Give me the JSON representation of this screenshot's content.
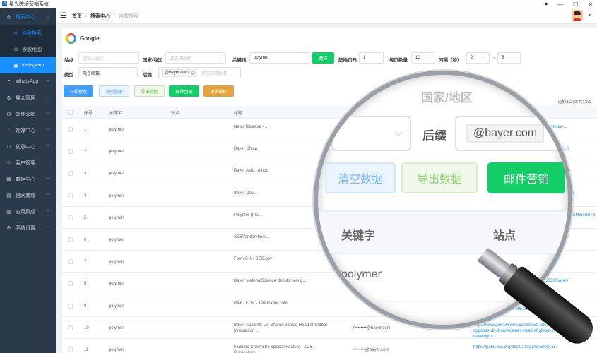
{
  "app": {
    "title": "星光跨境营销系统",
    "logo_letter": "S"
  },
  "window_controls": {
    "record": "⏺",
    "minimize": "—",
    "maximize": "☐",
    "close": "✕"
  },
  "sidebar": {
    "search_group": "搜索中心",
    "search_items": [
      {
        "label": "谷歌搜索",
        "icon": "google-icon",
        "glyph": "◎"
      },
      {
        "label": "谷歌地图",
        "icon": "map-pin-icon",
        "glyph": "⊙"
      },
      {
        "label": "Instagram",
        "icon": "instagram-icon",
        "glyph": "▣"
      }
    ],
    "groups": [
      {
        "label": "WhatsApp",
        "icon": "whatsapp-icon",
        "glyph": "◔"
      },
      {
        "label": "展会管理",
        "icon": "exhibition-icon",
        "glyph": "⚙"
      },
      {
        "label": "邮件营销",
        "icon": "mail-icon",
        "glyph": "✉"
      },
      {
        "label": "社媒中心",
        "icon": "social-icon",
        "glyph": "◌"
      },
      {
        "label": "创意中心",
        "icon": "creative-icon",
        "glyph": "☐"
      },
      {
        "label": "客户管理",
        "icon": "customer-icon",
        "glyph": "☺"
      },
      {
        "label": "数据中心",
        "icon": "data-icon",
        "glyph": "▦"
      },
      {
        "label": "官网商城",
        "icon": "shop-icon",
        "glyph": "▤"
      },
      {
        "label": "应用集成",
        "icon": "apps-icon",
        "glyph": "▥"
      },
      {
        "label": "系统设置",
        "icon": "settings-icon",
        "glyph": "⚙"
      }
    ]
  },
  "header": {
    "crumbs": [
      "首页",
      "搜索中心",
      "谷歌搜索"
    ]
  },
  "engine": {
    "name": "Google"
  },
  "form": {
    "site_label": "站点",
    "site_placeholder": "请输入站点",
    "country_label": "国家/地区",
    "country_placeholder": "请选择国家",
    "keyword_label": "关键词",
    "keyword_value": "polymer",
    "translate_btn": "翻译",
    "start_page_label": "起始页码",
    "start_page_value": "1",
    "per_page_label": "每页数量",
    "per_page_value": "10",
    "interval_label": "间隔（秒）",
    "interval_min": "2",
    "interval_dash": "~",
    "interval_max": "5",
    "type_label": "类型",
    "type_value": "电子邮箱",
    "suffix_label": "后缀",
    "suffix_tag": "@bayer.com",
    "suffix_placeholder": "添加邮箱后缀"
  },
  "actions": {
    "start": "开始搜索",
    "clear": "清空数据",
    "export": "导出数据",
    "email": "邮件营销",
    "more": "更多操作"
  },
  "summary": "已抓取2页/共12条",
  "table": {
    "headers": [
      "序号",
      "关键字",
      "站点",
      "标题"
    ],
    "rows": [
      {
        "no": "1",
        "kw": "polymer",
        "title": "News Release - ...",
        "email": "",
        "url": "...bayer.com/sites/default/files/otto-bayer-medal-..."
      },
      {
        "no": "2",
        "kw": "polymer",
        "title": "Bayer China",
        "email": "",
        "url": "...bayer.com.cn/index.php/AboutBayer/BayerChi...?lw=us"
      },
      {
        "no": "3",
        "kw": "polymer",
        "title": "Bayer Akti... d-hoc",
        "email": "",
        "url": "...bayer.de/news/adhoc/bayer-aktienge...ons-ipo-for-covestro/897155"
      },
      {
        "no": "4",
        "kw": "polymer",
        "title": "Bayer Dev...",
        "email": "",
        "url": "...systems.com/news-events/bayer-deve...gnostic-test-for-cancer-patients-fdge..."
      },
      {
        "no": "5",
        "kw": "polymer",
        "title": "Polymer (Pla...",
        "email": "",
        "url": "...com/materials/polymers/properties/sup...tionID=PC&MinorID=3"
      },
      {
        "no": "6",
        "kw": "polymer",
        "title": "SESVanderHave...",
        "email": "",
        "url": "...m/news/collaboration_for_new_..."
      },
      {
        "no": "7",
        "kw": "polymer",
        "title": "Form 6-K - SEC.gov",
        "email": "",
        "url": "...001433/0001..."
      },
      {
        "no": "8",
        "kw": "polymer",
        "title": "Bayer MaterialScience debuts new g...",
        "email": "",
        "url": "https://www.ledsmagazine.com/...16683650/bayer-materialscience-deb..."
      },
      {
        "no": "9",
        "kw": "polymer",
        "title": "BAY - EUR - TeleTrader.com",
        "email": "",
        "url": "https://www.teletrader.com/bayer-ag-namens-aktie/stocks/profile/tts-4951651"
      },
      {
        "no": "10",
        "kw": "polymer",
        "title": "Bayer Appoints Dr. Sharon James Head of Global Innovati on ...",
        "email": "r••••••••@bayer.com",
        "url": "https://www.prnewswire.com/news-releases/bayer-appoints-dr-sharon-james-head-of-global-innovation--developm..."
      },
      {
        "no": "11",
        "kw": "polymer",
        "title": "Fluorine Chemistry Special Feature - ACS Publications",
        "email": "••••••••@bayer.com",
        "url": "https://pubs.acs.org/doi/10.1021/op500216s"
      }
    ]
  },
  "zoom": {
    "country_label": "国家/地区",
    "suffix_label": "后缀",
    "suffix_value": "@bayer.com",
    "clear": "清空数据",
    "export": "导出数据",
    "email": "邮件营销",
    "th_keyword": "关键字",
    "th_site": "站点",
    "cell_keyword": "polymer"
  }
}
